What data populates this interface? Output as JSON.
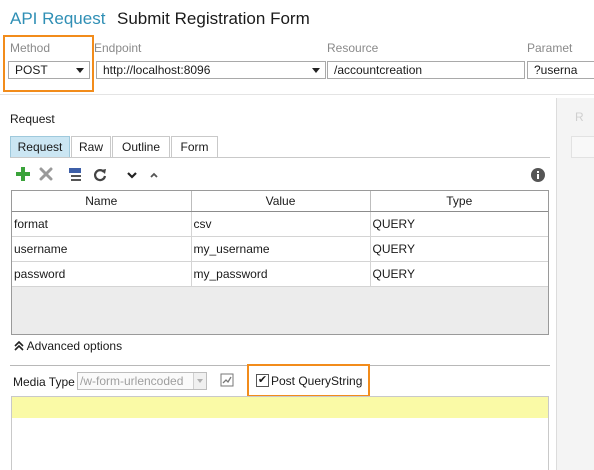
{
  "header": {
    "accent_title": "API Request",
    "title": "Submit Registration Form"
  },
  "columns": {
    "method_label": "Method",
    "endpoint_label": "Endpoint",
    "resource_label": "Resource",
    "params_label": "Paramet"
  },
  "fields": {
    "method": "POST",
    "endpoint": "http://localhost:8096",
    "resource": "/accountcreation",
    "params": "?userna"
  },
  "request": {
    "section_label": "Request",
    "tabs": [
      {
        "label": "Request",
        "active": true
      },
      {
        "label": "Raw",
        "active": false
      },
      {
        "label": "Outline",
        "active": false
      },
      {
        "label": "Form",
        "active": false
      }
    ],
    "toolbar_icons": [
      "add-icon",
      "delete-icon",
      "url-encode-icon",
      "refresh-icon",
      "move-down-icon",
      "move-up-icon",
      "info-icon"
    ],
    "grid": {
      "headers": [
        "Name",
        "Value",
        "Type"
      ],
      "rows": [
        {
          "name": "format",
          "value": "csv",
          "type": "QUERY"
        },
        {
          "name": "username",
          "value": "my_username",
          "type": "QUERY"
        },
        {
          "name": "password",
          "value": "my_password",
          "type": "QUERY"
        }
      ]
    },
    "advanced_label": "Advanced options",
    "media_type_label": "Media Type",
    "media_type_value": "/w-form-urlencoded",
    "post_querystring_label": "Post QueryString",
    "post_querystring_checked": true
  },
  "right_panel": {
    "ghost_label": "R"
  },
  "colors": {
    "accent": "#2f8fb5",
    "highlight_border": "#f28c1b",
    "active_tab": "#cbe6f3",
    "body_line": "#fafaa6"
  }
}
